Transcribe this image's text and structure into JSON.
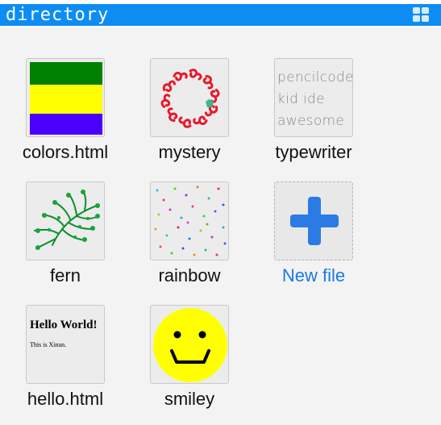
{
  "window": {
    "title": "directory",
    "view_toggle_icon": "grid-view-icon"
  },
  "files": [
    {
      "label": "colors.html",
      "icon": "color-stripes-thumbnail"
    },
    {
      "label": "mystery",
      "icon": "swirl-pattern-thumbnail"
    },
    {
      "label": "typewriter",
      "icon": "typewriter-text-thumbnail",
      "preview_text": [
        "pencilcode",
        "kid ide",
        "awesome"
      ]
    },
    {
      "label": "fern",
      "icon": "fern-thumbnail"
    },
    {
      "label": "rainbow",
      "icon": "rainbow-dots-thumbnail"
    },
    {
      "label": "New file",
      "icon": "plus-icon"
    },
    {
      "label": "hello.html",
      "icon": "html-page-thumbnail",
      "preview_heading": "Hello World!",
      "preview_body": "This is Xinan."
    },
    {
      "label": "smiley",
      "icon": "smiley-face-thumbnail"
    }
  ],
  "colors": {
    "titlebar": "#0d8df3",
    "newfile_link": "#1a78e6",
    "plus": "#2a7be4"
  }
}
